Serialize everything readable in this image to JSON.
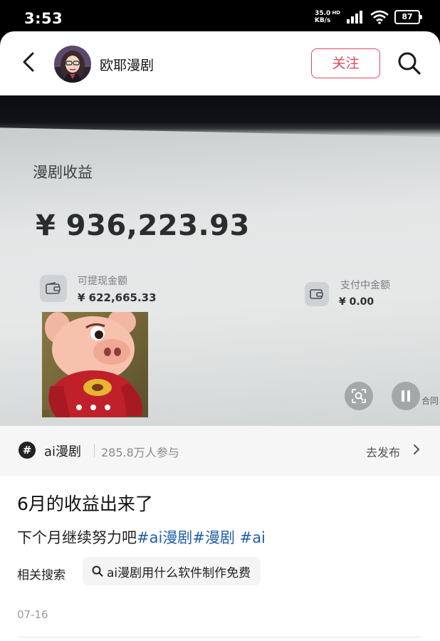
{
  "status_bar": {
    "time": "3:53",
    "net_speed_value": "35.0",
    "net_speed_unit": "KB/s",
    "hd_label": "HD",
    "battery": "87"
  },
  "header": {
    "author_name": "欧耶漫剧",
    "follow_label": "关注"
  },
  "media": {
    "card_title": "漫剧收益",
    "total_amount": "¥ 936,223.93",
    "withdrawable_label": "可提现金额",
    "withdrawable_value": "¥ 622,665.33",
    "paying_label": "支付中金额",
    "paying_value": "¥ 0.00",
    "edge_text": "合同",
    "is_playing": true
  },
  "topic": {
    "symbol": "#",
    "name": "ai漫剧",
    "participants": "285.8万人参与",
    "publish_label": "去发布"
  },
  "post": {
    "title": "6月的收益出来了",
    "body_text": "下个月继续努力吧",
    "tags": [
      "#ai漫剧",
      "#漫剧",
      " #ai"
    ],
    "related_label": "相关搜索",
    "related_query": "ai漫剧用什么软件制作免费",
    "date": "07-16"
  },
  "colors": {
    "accent": "#e0475e",
    "tag": "#1f5fa8"
  }
}
